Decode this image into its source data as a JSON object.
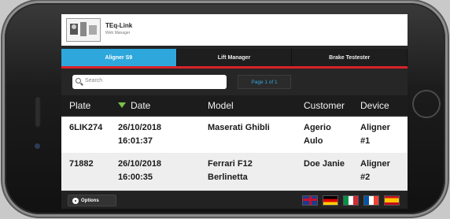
{
  "header": {
    "app_name": "TEq-Link",
    "app_subtitle": "Web Manager"
  },
  "tabs": [
    {
      "label": "Aligner S9",
      "active": true
    },
    {
      "label": "Lift Manager",
      "active": false
    },
    {
      "label": "Brake Testester",
      "active": false
    }
  ],
  "search": {
    "placeholder": "Search"
  },
  "pager": {
    "label": "Page 1 of 1"
  },
  "table": {
    "columns": [
      "Plate",
      "Date",
      "Model",
      "Customer",
      "Device"
    ],
    "sorted_column": "Date",
    "rows": [
      {
        "plate": "6LIK274",
        "date": "26/10/2018",
        "time": "16:01:37",
        "model": "Maserati Ghibli",
        "model_line2": "",
        "customer": "Agerio",
        "customer_line2": "Aulo",
        "device": "Aligner",
        "device_line2": "#1"
      },
      {
        "plate": "71882",
        "date": "26/10/2018",
        "time": "16:00:35",
        "model": "Ferrari F12",
        "model_line2": "Berlinetta",
        "customer": "Doe Janie",
        "customer_line2": "",
        "device": "Aligner",
        "device_line2": "#2"
      }
    ]
  },
  "footer": {
    "options_label": "Options",
    "flags": [
      "flag-uk",
      "flag-de",
      "flag-it",
      "flag-fr",
      "flag-es"
    ]
  },
  "colors": {
    "accent": "#2ea7dd",
    "tab_underline": "#d8222a",
    "sort_arrow": "#7ec04a"
  }
}
